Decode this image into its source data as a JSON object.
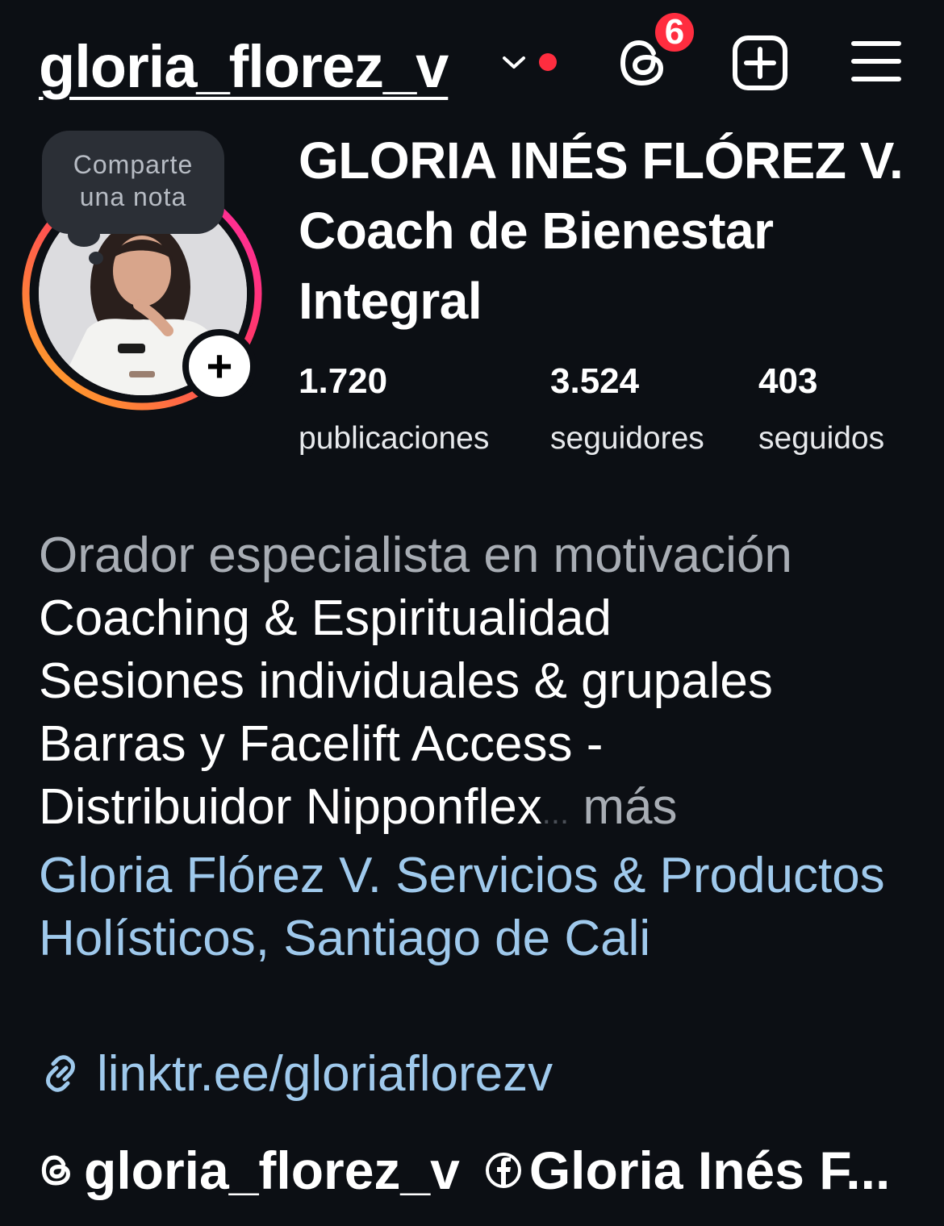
{
  "colors": {
    "background": "#0c0f14",
    "text": "#ffffff",
    "muted": "#a8adb4",
    "link": "#9fc9ec",
    "badge": "#ff2d3f",
    "story_ring_start": "#ff2aa8",
    "story_ring_end": "#ffb31f"
  },
  "header": {
    "username": "gloria_florez_v",
    "dropdown_icon": "chevron-down-icon",
    "live_dot_icon": "red-dot-icon",
    "threads_icon": "threads-icon",
    "notification_count": "6",
    "create_icon": "plus-square-icon",
    "menu_icon": "hamburger-menu-icon"
  },
  "profile": {
    "note_bubble": {
      "line1": "Comparte",
      "line2": "una nota"
    },
    "add_story_label": "+",
    "full_name": "GLORIA INÉS FLÓREZ V. Coach de Bienestar Integral",
    "stats": [
      {
        "value": "1.720",
        "label": "publicaciones"
      },
      {
        "value": "3.524",
        "label": "seguidores"
      },
      {
        "value": "403",
        "label": "seguidos"
      }
    ]
  },
  "bio": {
    "category": "Orador especialista en motivación",
    "lines": [
      "Coaching & Espiritualidad",
      "Sesiones individuales & grupales",
      "Barras y Facelift Access -"
    ],
    "last_line": "Distribuidor Nipponflex",
    "ellipsis": "...",
    "more_label": "más",
    "place": "Gloria Flórez V. Servicios & Productos Holísticos, Santiago de Cali",
    "link_icon": "link-icon",
    "link": "linktr.ee/gloriaflorezv"
  },
  "bottom_links": {
    "threads_icon": "threads-icon",
    "threads_handle": "gloria_florez_v",
    "facebook_icon": "facebook-icon",
    "facebook_name": "Gloria Inés F..."
  }
}
